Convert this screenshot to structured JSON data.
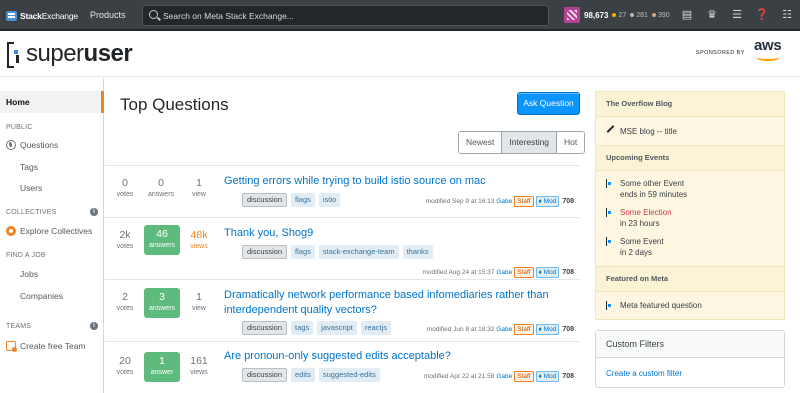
{
  "topbar": {
    "brand_bold": "Stack",
    "brand_light": "Exchange",
    "products_label": "Products",
    "search_placeholder": "Search on Meta Stack Exchange...",
    "reputation": "98,673",
    "gold_count": "27",
    "silver_count": "281",
    "bronze_count": "390",
    "gold_color": "#f1b600",
    "silver_color": "#b4b8bc",
    "bronze_color": "#d1a684",
    "icons": [
      "inbox-icon",
      "achievements-icon",
      "review-icon",
      "help-icon",
      "site-switcher-icon"
    ]
  },
  "site": {
    "logo_light": "super",
    "logo_bold": "user",
    "sponsored_label": "SPONSORED BY",
    "sponsor_name": "aws"
  },
  "leftnav": {
    "home": "Home",
    "public_head": "PUBLIC",
    "questions": "Questions",
    "tags": "Tags",
    "users": "Users",
    "collectives_head": "COLLECTIVES",
    "explore_collectives": "Explore Collectives",
    "find_job_head": "FIND A JOB",
    "jobs": "Jobs",
    "companies": "Companies",
    "teams_head": "TEAMS",
    "create_team": "Create free Team"
  },
  "main": {
    "title": "Top Questions",
    "ask_button": "Ask Question",
    "filters": [
      "Newest",
      "Interesting",
      "Hot"
    ],
    "selected_filter": "Interesting",
    "questions": [
      {
        "votes": "0",
        "votes_label": "votes",
        "answers": "0",
        "answers_label": "answers",
        "views": "1",
        "views_label": "view",
        "title": "Getting errors while trying to build istio source on mac",
        "tags": [
          "discussion",
          "flags",
          "istio"
        ],
        "modified": "modified Sep 9 at 16:13",
        "user": "Gabe",
        "staff": "Staff",
        "mod": "♦ Mod",
        "rep": "708"
      },
      {
        "votes": "2k",
        "votes_label": "votes",
        "answers": "46",
        "answers_label": "answers",
        "views": "48k",
        "views_label": "views",
        "title": "Thank you, Shog9",
        "tags": [
          "discussion",
          "flags",
          "stack-exchange-team",
          "thanks"
        ],
        "modified": "modified Aug 24 at 15:37",
        "user": "Gabe",
        "staff": "Staff",
        "mod": "♦ Mod",
        "rep": "708"
      },
      {
        "votes": "2",
        "votes_label": "votes",
        "answers": "3",
        "answers_label": "answers",
        "views": "1",
        "views_label": "view",
        "title": "Dramatically network performance based infomediaries rather than interdependent quality vectors?",
        "tags": [
          "discussion",
          "tags",
          "javascript",
          "reactjs"
        ],
        "modified": "modified Jun 8 at 18:32",
        "user": "Gabe",
        "staff": "Staff",
        "mod": "♦ Mod",
        "rep": "708"
      },
      {
        "votes": "20",
        "votes_label": "votes",
        "answers": "1",
        "answers_label": "answer",
        "views": "161",
        "views_label": "views",
        "title": "Are pronoun-only suggested edits acceptable?",
        "tags": [
          "discussion",
          "edits",
          "suggested-edits"
        ],
        "modified": "modified Apr 22 at 21:58",
        "user": "Gabe",
        "staff": "Staff",
        "mod": "♦ Mod",
        "rep": "708"
      }
    ]
  },
  "sidebar": {
    "blog_head": "The Overflow Blog",
    "blog_item": "MSE blog -- title",
    "events_head": "Upcoming Events",
    "events": [
      {
        "name": "Some other Event",
        "when": "ends in 59 minutes"
      },
      {
        "name": "Some Election",
        "when": "in 23 hours"
      },
      {
        "name": "Some Event",
        "when": "in 2 days"
      }
    ],
    "featured_head": "Featured on Meta",
    "featured_item": "Meta featured question",
    "custom_filters_head": "Custom Filters",
    "custom_filters_link": "Create a custom filter"
  }
}
